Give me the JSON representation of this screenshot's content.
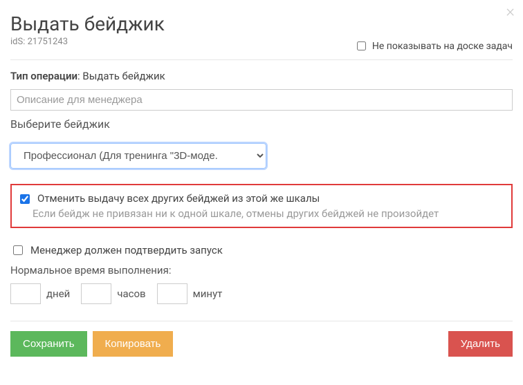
{
  "modal": {
    "title": "Выдать бейджик",
    "ids_label": "idS: 21751243",
    "hide_on_board_label": "Не показывать на доске задач",
    "hide_on_board_checked": false
  },
  "form": {
    "op_type_prefix": "Тип операции",
    "op_type_value": "Выдать бейджик",
    "description_placeholder": "Описание для менеджера",
    "choose_badge_label": "Выберите бейджик",
    "badge_selected": "Профессионал (Для тренинга \"3D-моде.",
    "cancel_others": {
      "checked": true,
      "main": "Отменить выдачу всех других бейджей из этой же шкалы",
      "sub": "Если бейдж не привязан ни к одной шкале, отмены других бейджей не произойдет"
    },
    "manager_confirm": {
      "checked": false,
      "label": "Менеджер должен подтвердить запуск"
    },
    "exec_time_label": "Нормальное время выполнения:",
    "units": {
      "days": "дней",
      "hours": "часов",
      "minutes": "минут"
    },
    "values": {
      "days": "",
      "hours": "",
      "minutes": ""
    }
  },
  "buttons": {
    "save": "Сохранить",
    "copy": "Копировать",
    "delete": "Удалить"
  }
}
